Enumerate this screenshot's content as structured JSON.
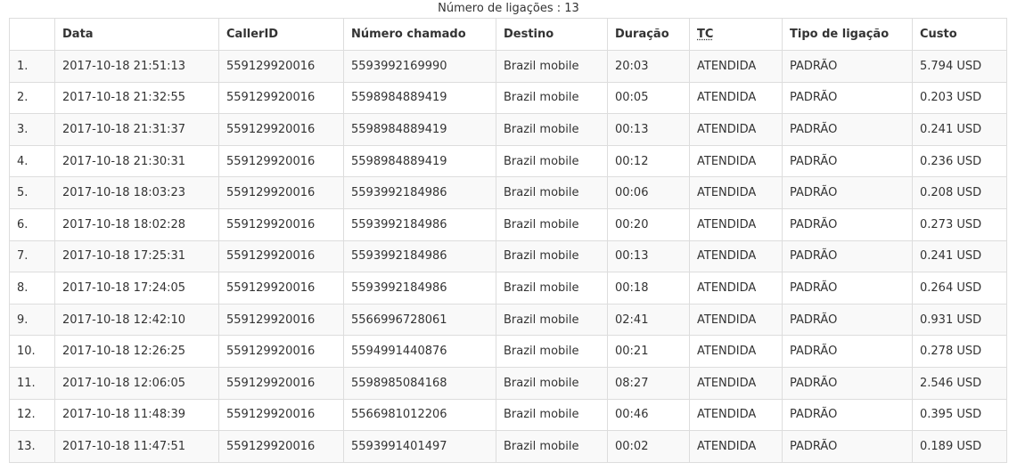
{
  "caption": "Número de ligações : 13",
  "table": {
    "columns": [
      "",
      "Data",
      "CallerID",
      "Número chamado",
      "Destino",
      "Duração",
      "TC",
      "Tipo de ligação",
      "Custo"
    ],
    "rows": [
      [
        "1.",
        "2017-10-18 21:51:13",
        "559129920016",
        "5593992169990",
        "Brazil mobile",
        "20:03",
        "ATENDIDA",
        "PADRÃO",
        "5.794 USD"
      ],
      [
        "2.",
        "2017-10-18 21:32:55",
        "559129920016",
        "5598984889419",
        "Brazil mobile",
        "00:05",
        "ATENDIDA",
        "PADRÃO",
        "0.203 USD"
      ],
      [
        "3.",
        "2017-10-18 21:31:37",
        "559129920016",
        "5598984889419",
        "Brazil mobile",
        "00:13",
        "ATENDIDA",
        "PADRÃO",
        "0.241 USD"
      ],
      [
        "4.",
        "2017-10-18 21:30:31",
        "559129920016",
        "5598984889419",
        "Brazil mobile",
        "00:12",
        "ATENDIDA",
        "PADRÃO",
        "0.236 USD"
      ],
      [
        "5.",
        "2017-10-18 18:03:23",
        "559129920016",
        "5593992184986",
        "Brazil mobile",
        "00:06",
        "ATENDIDA",
        "PADRÃO",
        "0.208 USD"
      ],
      [
        "6.",
        "2017-10-18 18:02:28",
        "559129920016",
        "5593992184986",
        "Brazil mobile",
        "00:20",
        "ATENDIDA",
        "PADRÃO",
        "0.273 USD"
      ],
      [
        "7.",
        "2017-10-18 17:25:31",
        "559129920016",
        "5593992184986",
        "Brazil mobile",
        "00:13",
        "ATENDIDA",
        "PADRÃO",
        "0.241 USD"
      ],
      [
        "8.",
        "2017-10-18 17:24:05",
        "559129920016",
        "5593992184986",
        "Brazil mobile",
        "00:18",
        "ATENDIDA",
        "PADRÃO",
        "0.264 USD"
      ],
      [
        "9.",
        "2017-10-18 12:42:10",
        "559129920016",
        "5566996728061",
        "Brazil mobile",
        "02:41",
        "ATENDIDA",
        "PADRÃO",
        "0.931 USD"
      ],
      [
        "10.",
        "2017-10-18 12:26:25",
        "559129920016",
        "5594991440876",
        "Brazil mobile",
        "00:21",
        "ATENDIDA",
        "PADRÃO",
        "0.278 USD"
      ],
      [
        "11.",
        "2017-10-18 12:06:05",
        "559129920016",
        "5598985084168",
        "Brazil mobile",
        "08:27",
        "ATENDIDA",
        "PADRÃO",
        "2.546 USD"
      ],
      [
        "12.",
        "2017-10-18 11:48:39",
        "559129920016",
        "5566981012206",
        "Brazil mobile",
        "00:46",
        "ATENDIDA",
        "PADRÃO",
        "0.395 USD"
      ],
      [
        "13.",
        "2017-10-18 11:47:51",
        "559129920016",
        "5593991401497",
        "Brazil mobile",
        "00:02",
        "ATENDIDA",
        "PADRÃO",
        "0.189 USD"
      ]
    ]
  }
}
